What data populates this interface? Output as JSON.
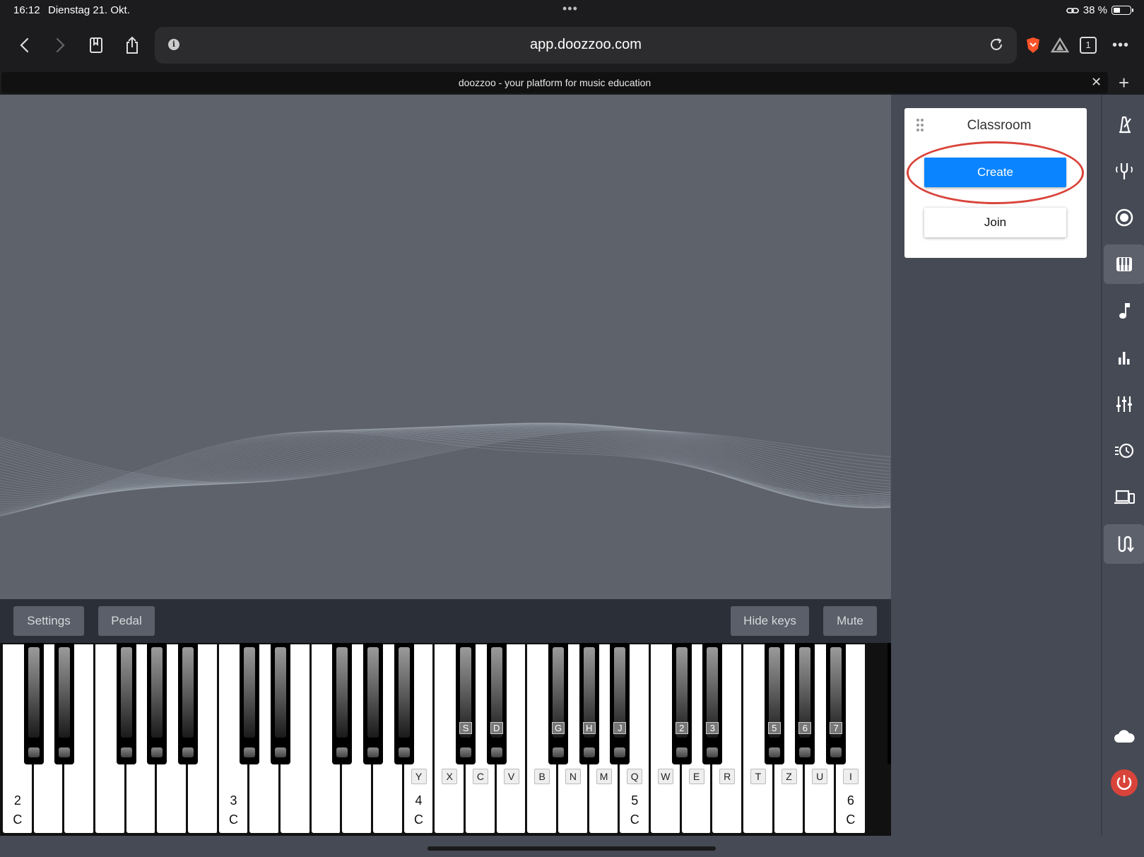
{
  "status": {
    "time": "16:12",
    "date": "Dienstag 21. Okt.",
    "battery": "38 %",
    "battery_level": 0.38
  },
  "browser": {
    "url": "app.doozzoo.com",
    "tab_title": "doozzoo - your platform for music education",
    "tab_count": "1"
  },
  "classroom": {
    "title": "Classroom",
    "create_label": "Create",
    "join_label": "Join"
  },
  "piano_controls": {
    "settings": "Settings",
    "pedal": "Pedal",
    "hide_keys": "Hide keys",
    "mute": "Mute"
  },
  "keyboard": {
    "white_keys": [
      {
        "octave": "2",
        "note": "C"
      },
      {},
      {},
      {},
      {},
      {},
      {},
      {
        "octave": "3",
        "note": "C"
      },
      {},
      {},
      {},
      {},
      {},
      {
        "label": "Y",
        "octave": "4",
        "note": "C"
      },
      {
        "label": "X"
      },
      {
        "label": "C"
      },
      {
        "label": "V"
      },
      {
        "label": "B"
      },
      {
        "label": "N"
      },
      {
        "label": "M"
      },
      {
        "label": "Q",
        "octave": "5",
        "note": "C"
      },
      {
        "label": "W"
      },
      {
        "label": "E"
      },
      {
        "label": "R"
      },
      {
        "label": "T"
      },
      {
        "label": "Z"
      },
      {
        "label": "U"
      },
      {
        "label": "I",
        "octave": "6",
        "note": "C"
      }
    ],
    "black_keys": [
      {},
      {},
      {},
      {},
      {},
      {},
      {},
      {},
      {},
      {},
      {
        "label": "S"
      },
      {
        "label": "D"
      },
      {
        "label": "G"
      },
      {
        "label": "H"
      },
      {
        "label": "J"
      },
      {
        "label": "2"
      },
      {
        "label": "3"
      },
      {
        "label": "5"
      },
      {
        "label": "6"
      },
      {
        "label": "7"
      },
      {}
    ]
  },
  "sidebar_icons": [
    "metronome-icon",
    "tuning-fork-icon",
    "record-icon",
    "piano-icon",
    "music-note-icon",
    "bar-chart-icon",
    "mixer-icon",
    "history-icon",
    "devices-icon",
    "route-icon"
  ],
  "colors": {
    "create": "#0a84ff",
    "highlight": "#d9443a",
    "power": "#d9443a"
  }
}
